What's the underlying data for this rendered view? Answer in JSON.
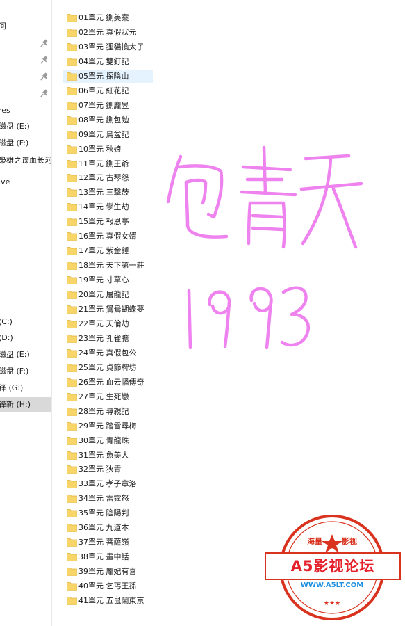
{
  "navigation": {
    "items": [
      {
        "label": "问",
        "pinned": false
      },
      {
        "label": "",
        "pinned": true
      },
      {
        "label": "",
        "pinned": true
      },
      {
        "label": "",
        "pinned": true
      },
      {
        "label": "",
        "pinned": true
      },
      {
        "label": "res",
        "pinned": false
      },
      {
        "label": "磁盘 (E:)",
        "pinned": false
      },
      {
        "label": "磁盘 (F:)",
        "pinned": false
      },
      {
        "label": "枭雄之谍血长河",
        "pinned": false
      },
      {
        "label": "ive",
        "pinned": false
      },
      {
        "label": "(C:)",
        "pinned": false
      },
      {
        "label": "(D:)",
        "pinned": false
      },
      {
        "label": "磁盘 (E:)",
        "pinned": false
      },
      {
        "label": "磁盘 (F:)",
        "pinned": false
      },
      {
        "label": "锋 (G:)",
        "pinned": false
      },
      {
        "label": "锋新 (H:)",
        "pinned": false,
        "selected": true
      }
    ]
  },
  "files": [
    "01單元 鍘美案",
    "02單元 真假狀元",
    "03單元 狸貓換太子",
    "04單元 雙釘記",
    "05單元 探陰山",
    "06單元 紅花記",
    "07單元 鍘龐昱",
    "08單元 鍘包勉",
    "09單元 烏盆記",
    "10單元 秋娘",
    "11單元 鍘王爺",
    "12單元 古琴怨",
    "13單元 三擊鼓",
    "14單元 孿生劫",
    "15單元 報恩亭",
    "16單元 真假女婿",
    "17單元 紫金錘",
    "18單元 天下第一莊",
    "19單元 寸草心",
    "20單元 屠龍記",
    "21單元 鴛鴦蝴蝶夢",
    "22單元 天倫劫",
    "23單元 孔雀膽",
    "24單元 真假包公",
    "25單元 貞節牌坊",
    "26單元 血云幡傳奇",
    "27單元 生死戀",
    "28單元 尋親記",
    "29單元 踏雪尋梅",
    "30單元 青龍珠",
    "31單元 魚美人",
    "32單元 狄青",
    "33單元 孝子章洛",
    "34單元 雷霆怒",
    "35單元 陰陽判",
    "36單元 九道本",
    "37單元 菩薩嶺",
    "38單元 畫中話",
    "39單元 龐妃有喜",
    "40單元 乞丐王孫",
    "41單元 五鼠鬧東京"
  ],
  "hovered_file_index": 4,
  "handwriting": {
    "line1": "包青天",
    "line2": "1993",
    "color": "#ee82ee"
  },
  "watermark": {
    "top_left": "海量",
    "top_right": "影视",
    "main": "A5影视论坛",
    "url": "WWW.A5LT.COM",
    "color": "#d9331f",
    "url_color": "#1f8fe0"
  },
  "colors": {
    "folder": "#f7d569",
    "folder_dark": "#e0b43c",
    "selection": "#d9d9d9",
    "hover": "#e5f3ff"
  }
}
